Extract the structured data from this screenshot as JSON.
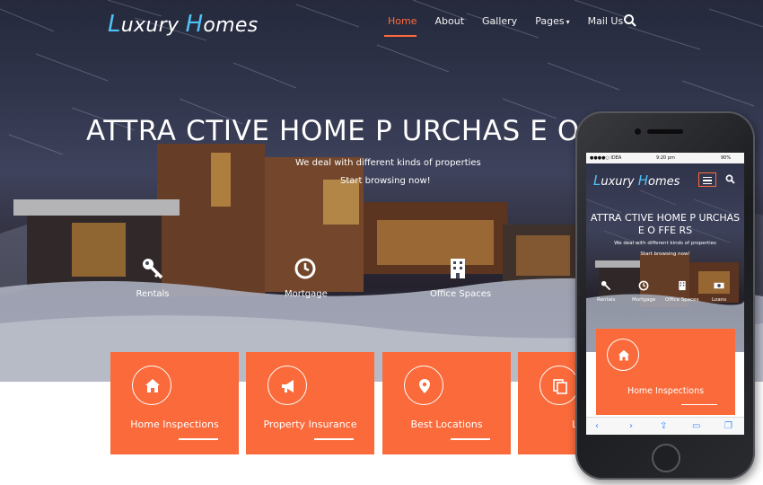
{
  "brand": {
    "logo_cap1": "L",
    "logo_rest1": "uxury ",
    "logo_cap2": "H",
    "logo_rest2": "omes"
  },
  "nav": {
    "items": [
      "Home",
      "About",
      "Gallery",
      "Pages",
      "Mail Us"
    ],
    "active_index": 0,
    "pages_caret": "▾"
  },
  "hero": {
    "headline": "ATTRA CTIVE HOME P URCHAS E O",
    "subline1": "We deal with different kinds of properties",
    "subline2": "Start browsing now!"
  },
  "features": [
    {
      "label": "Rentals",
      "icon": "key-icon"
    },
    {
      "label": "Mortgage",
      "icon": "clock-icon"
    },
    {
      "label": "Office Spaces",
      "icon": "building-icon"
    }
  ],
  "cards": [
    {
      "title": "Home Inspections",
      "icon": "home-icon"
    },
    {
      "title": "Property Insurance",
      "icon": "megaphone-icon"
    },
    {
      "title": "Best Locations",
      "icon": "map-pin-icon"
    },
    {
      "title": "Lots",
      "icon": "copy-icon"
    }
  ],
  "phone": {
    "status": {
      "carrier": "●●●●○ IDEA",
      "time": "9:20 pm",
      "battery": "90%"
    },
    "headline": "ATTRA CTIVE HOME P URCHAS E O FFE RS",
    "subline1": "We deal with different kinds of properties",
    "subline2": "Start browsing now!",
    "features": [
      "Rentals",
      "Mortgage",
      "Office Spaces",
      "Loans"
    ],
    "card_title": "Home Inspections",
    "toolbar": [
      "‹",
      "›",
      "⇪",
      "▭",
      "❐"
    ]
  },
  "colors": {
    "accent": "#fa6a3a",
    "logo_accent": "#4fc3f7",
    "nav_active": "#ff6a3d",
    "safari_blue": "#3d8bfd"
  }
}
